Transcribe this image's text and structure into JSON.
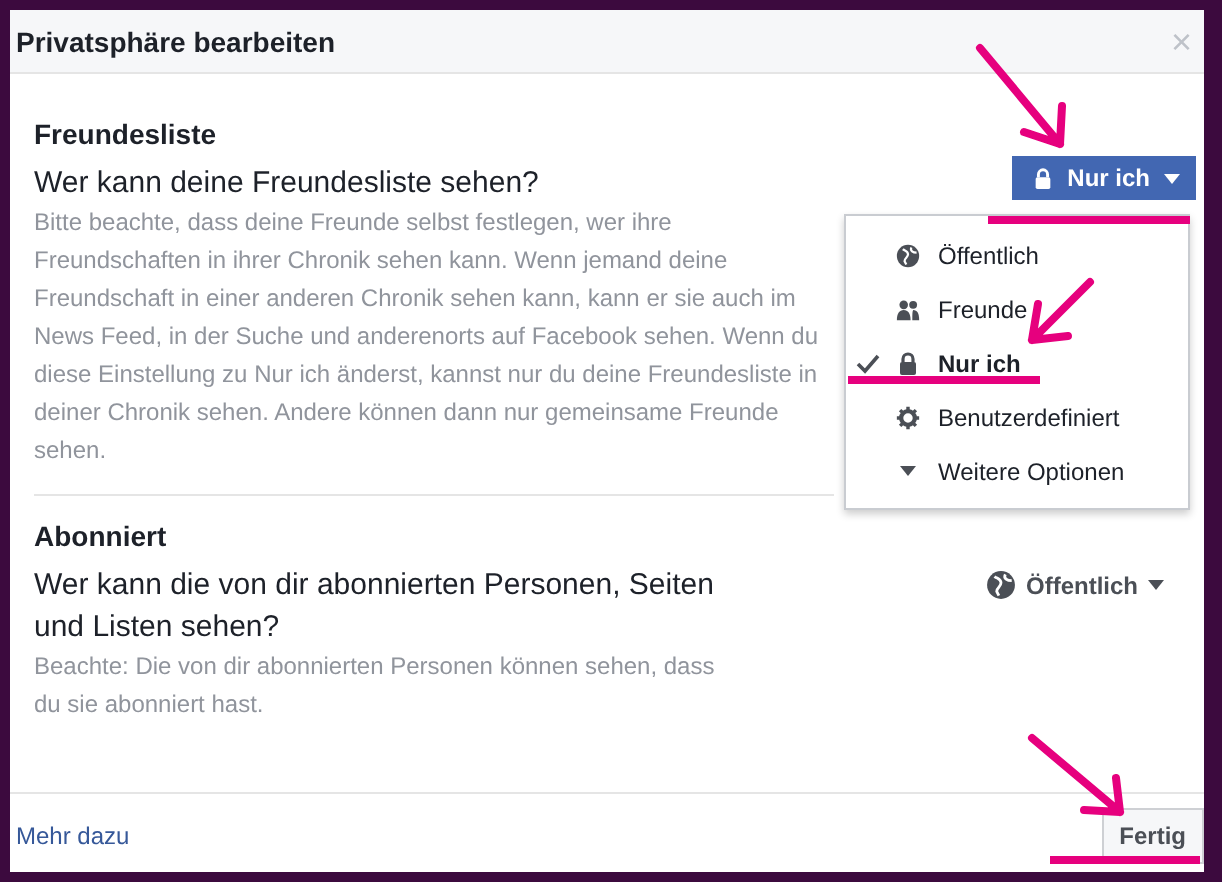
{
  "dialog": {
    "title": "Privatsphäre bearbeiten",
    "close": "×"
  },
  "sections": [
    {
      "heading": "Freundesliste",
      "question": "Wer kann deine Freundesliste sehen?",
      "note": "Bitte beachte, dass deine Freunde selbst festlegen, wer ihre Freundschaften in ihrer Chronik sehen kann. Wenn jemand deine Freundschaft in einer anderen Chronik sehen kann, kann er sie auch im News Feed, in der Suche und anderenorts auf Facebook sehen. Wenn du diese Einstellung zu Nur ich änderst, kannst nur du deine Freundesliste in deiner Chronik sehen. Andere können dann nur gemeinsame Freunde sehen.",
      "audience": {
        "label": "Nur ich",
        "kind": "lock",
        "open": true
      }
    },
    {
      "heading": "Abonniert",
      "question": "Wer kann die von dir abonnierten Personen, Seiten und Listen sehen?",
      "note": "Beachte: Die von dir abonnierten Personen können sehen, dass du sie abonniert hast.",
      "audience": {
        "label": "Öffentlich",
        "kind": "globe",
        "open": false
      }
    }
  ],
  "menu": [
    {
      "label": "Öffentlich",
      "kind": "globe",
      "selected": false
    },
    {
      "label": "Freunde",
      "kind": "friends",
      "selected": false
    },
    {
      "label": "Nur ich",
      "kind": "lock",
      "selected": true
    },
    {
      "label": "Benutzerdefiniert",
      "kind": "gear",
      "selected": false
    },
    {
      "label": "Weitere Optionen",
      "kind": "caret",
      "selected": false
    }
  ],
  "footer": {
    "link": "Mehr dazu",
    "button": "Fertig"
  }
}
